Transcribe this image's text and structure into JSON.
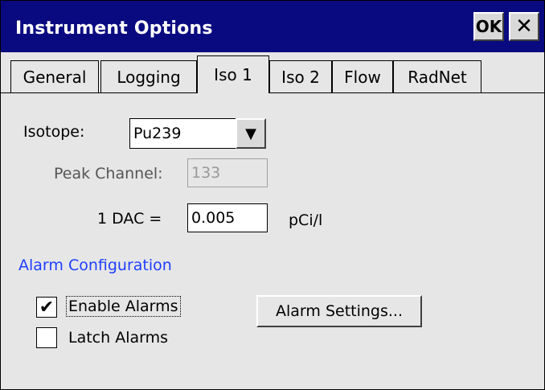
{
  "window": {
    "title": "Instrument Options",
    "ok_label": "OK",
    "close_glyph": "✕"
  },
  "tabs": [
    {
      "label": "General",
      "active": false
    },
    {
      "label": "Logging",
      "active": false
    },
    {
      "label": "Iso 1",
      "active": true
    },
    {
      "label": "Iso 2",
      "active": false
    },
    {
      "label": "Flow",
      "active": false
    },
    {
      "label": "RadNet",
      "active": false
    }
  ],
  "form": {
    "isotope_label": "Isotope:",
    "isotope_value": "Pu239",
    "peak_channel_label": "Peak Channel:",
    "peak_channel_value": "133",
    "dac_label": "1 DAC =",
    "dac_value": "0.005",
    "dac_unit": "pCi/l"
  },
  "alarms": {
    "section_title": "Alarm Configuration",
    "enable_label": "Enable Alarms",
    "enable_checked": true,
    "latch_label": "Latch Alarms",
    "latch_checked": false,
    "settings_button": "Alarm Settings..."
  },
  "icons": {
    "dropdown": "chevron-down-icon",
    "check": "checkmark-icon"
  }
}
